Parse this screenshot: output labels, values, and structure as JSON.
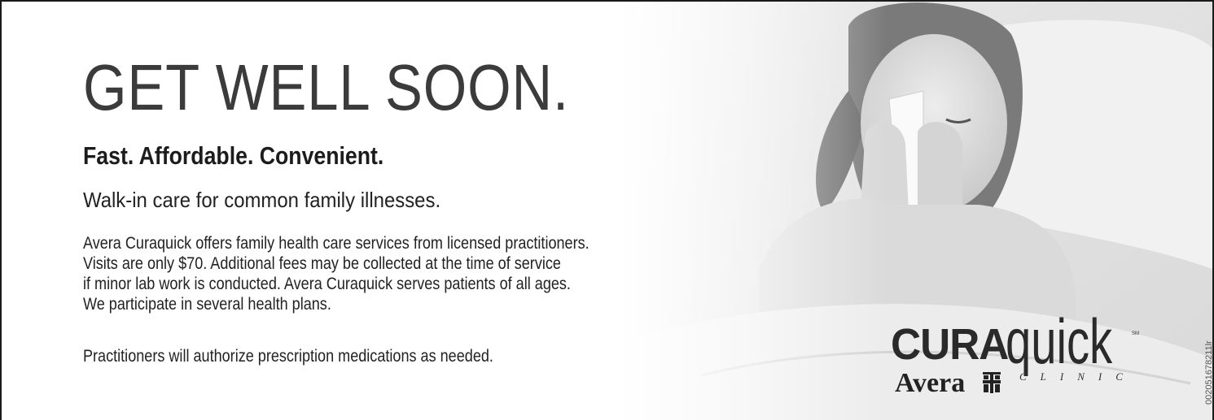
{
  "headline": "GET WELL SOON.",
  "tagline": "Fast. Affordable. Convenient.",
  "subhead": "Walk-in care for common family illnesses.",
  "body_paragraph_1": [
    "Avera Curaquick offers family health care services from licensed practitioners.",
    "Visits are only $70. Additional fees may be collected at the time of service",
    "if minor lab work is conducted. Avera Curaquick serves patients of all ages.",
    "We participate in several health plans."
  ],
  "body_paragraph_2": "Practitioners will authorize prescription medications as needed.",
  "logo": {
    "cura": "CURA",
    "quick": "quick",
    "sm": "SM",
    "avera": "Avera",
    "clinic": "CLINIC"
  },
  "ad_code": "002051678211lr",
  "photo_alt": "girl-sneezing-into-tissue-icon"
}
